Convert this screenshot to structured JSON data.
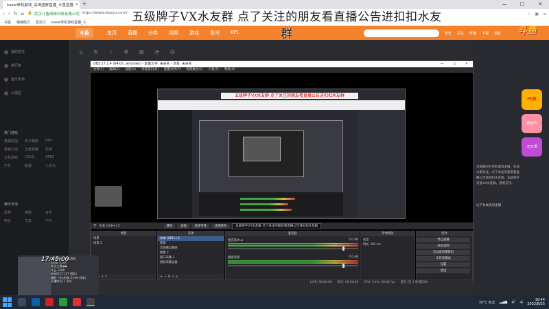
{
  "browser": {
    "tab_title": "kaew单机游戏_高清竖屏直播_斗鱼直播",
    "new_tab": "+",
    "window_controls": [
      "—",
      "□",
      "✕"
    ],
    "url_secure_label": "武汉斗鱼网络科技有限公司",
    "url": "https://www.douyu.com/",
    "bookmarks": [
      "书签",
      "柚柚助力",
      "爱加工",
      "kaew单机游戏直播_斗"
    ]
  },
  "overlay_title": "五级牌子VX水友群 点了关注的朋友看直播公告进扣扣水友群",
  "douyu": {
    "logo": "斗鱼",
    "nav": [
      "首页",
      "直播",
      "分类",
      "视频",
      "游戏",
      "鱼吧",
      "KPL"
    ],
    "header_right": [
      "历史",
      "关注",
      "开播",
      "下载",
      "消息"
    ],
    "big_logo": "斗鱼"
  },
  "sidebar": {
    "top_items": [
      "我的关注",
      "排行榜",
      "鱼乐天地",
      "公测区"
    ],
    "section_label": "热门游戏",
    "grid": [
      "英雄联盟",
      "和平精英",
      "DNF",
      "穿越火线",
      "王者荣耀",
      "原神",
      "主机游戏",
      "CSGO",
      "APEX",
      "户外",
      "颜值",
      "二次元"
    ],
    "section_label2": "娱乐天地",
    "grid2": [
      "星秀",
      "舞蹈",
      "音乐",
      "电台",
      "交友",
      "户外"
    ]
  },
  "right_panel": {
    "promo1": "PK赛",
    "promo2": "粉丝节",
    "promo3": "天天领",
    "text": "本直播间为单机游戏主播，欢迎大家关注，点了关注的朋友看直播公告进扣扣水友群，五级牌子可进VX水友群，感谢支持。",
    "note": "以下为本房间主播"
  },
  "page_tools": [
    "⌂",
    "✉",
    "☆",
    "⚙",
    "▤",
    "◔",
    "☺"
  ],
  "obs": {
    "title": "OBS 27.2.4 (64-bit, windows) - 配置文件: 未命名 - 场景: 未命名",
    "menu": [
      "文件(F)",
      "编辑(E)",
      "视图(V)",
      "停靠窗口(D)",
      "配置文件(P)",
      "场景集合(S)",
      "工具(T)",
      "帮助(H)"
    ],
    "source_label": "文本 (GDI+) 2",
    "buttons": [
      "属性",
      "滤镜",
      "选择字体",
      "选择颜色"
    ],
    "scroll_text": "五级牌子VX水友群 点了关注的朋友看直播公告进扣扣水友群",
    "docks": {
      "scenes": {
        "title": "场景",
        "items": [
          "场景",
          "场景 2"
        ]
      },
      "sources": {
        "title": "来源",
        "items": [
          "文本 (GDI+) 2",
          "图像",
          "音频输出捕获",
          "图像 2",
          "窗口采集 2",
          "视频采集设备"
        ]
      },
      "mixer": {
        "title": "混音器",
        "channels": [
          {
            "name": "麦克风/Aux",
            "db": "0.0 dB"
          },
          {
            "name": "桌面音频",
            "db": "0.0 dB"
          }
        ]
      },
      "transitions": {
        "title": "转场特效",
        "type": "淡出",
        "duration_label": "时长",
        "duration": "300 ms"
      },
      "controls": {
        "title": "控件",
        "items": [
          "停止直播",
          "开始录制",
          "启动虚拟摄像机",
          "工作室模式",
          "设置",
          "退出"
        ]
      }
    },
    "status": [
      "LIVE: 00:00:00",
      "REC: 00:00:00",
      "CPU: 3.9%, 60.00 fps",
      "延迟 (在 1 秒或其余)"
    ]
  },
  "preview": {
    "inner_title": "五级牌子VX水友群 点了关注的朋友看直播公告进扣扣水友群"
  },
  "webcam": {
    "clock": "17:45:00",
    "info": [
      "Dy直播间 单机游戏",
      "kaew 3.5万",
      "关注主播 ▶▶",
      "今日 1280",
      "粉丝团 [1] 17 (猫1)",
      "爆款 •3小时前 2小时 (5组)",
      "开播时间 1 小时"
    ]
  },
  "taskbar": {
    "weather": "30°C 多云",
    "ime": "中",
    "time": "10:44",
    "date": "2022/8/25"
  }
}
